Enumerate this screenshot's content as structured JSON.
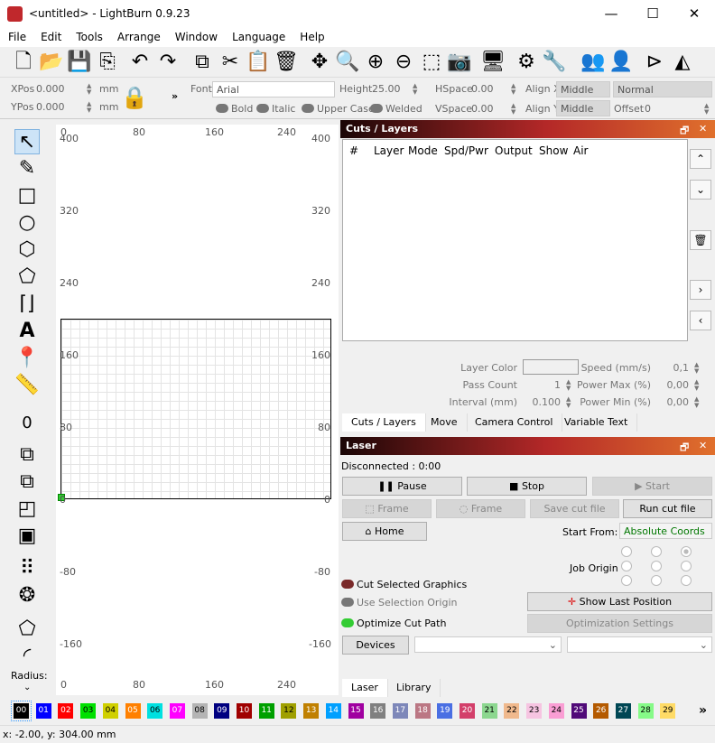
{
  "window": {
    "title": "<untitled> - LightBurn 0.9.23",
    "minimize": "—",
    "maximize": "☐",
    "close": "✕"
  },
  "menu": [
    "File",
    "Edit",
    "Tools",
    "Arrange",
    "Window",
    "Language",
    "Help"
  ],
  "toolbar": [
    "new-file",
    "open",
    "save",
    "import",
    "undo",
    "redo",
    "copy",
    "cut",
    "paste",
    "delete",
    "move",
    "zoom-to-page",
    "zoom-in",
    "zoom-out",
    "select-frame",
    "camera",
    "device",
    "settings",
    "tools",
    "users",
    "user",
    "flip-horizontal",
    "mirror"
  ],
  "props": {
    "xpos_label": "XPos",
    "xpos": "0.000",
    "ypos_label": "YPos",
    "ypos": "0.000",
    "unit": "mm",
    "more": "»",
    "font_label": "Font",
    "font": "Arial",
    "height_label": "Height",
    "height": "25.00",
    "hspace_label": "HSpace",
    "hspace": "0.00",
    "vspace_label": "VSpace",
    "vspace": "0.00",
    "alignx_label": "Align X",
    "alignx": "Middle",
    "aligny_label": "Align Y",
    "aligny": "Middle",
    "style": "Normal",
    "offset_label": "Offset",
    "offset": "0",
    "bold": "Bold",
    "italic": "Italic",
    "upper": "Upper Case",
    "welded": "Welded"
  },
  "tools": {
    "offset_label": "0",
    "radius_label": "Radius:"
  },
  "canvas": {
    "x_ticks": [
      "0",
      "80",
      "160",
      "240"
    ],
    "y_ticks": [
      "400",
      "320",
      "240",
      "160",
      "80",
      "0",
      "-80",
      "-160"
    ]
  },
  "cuts": {
    "title": "Cuts / Layers",
    "columns": [
      "#",
      "Layer",
      "Mode",
      "Spd/Pwr",
      "Output",
      "Show",
      "Air"
    ],
    "layer_color_label": "Layer Color",
    "pass_count_label": "Pass Count",
    "pass_count": "1",
    "interval_label": "Interval (mm)",
    "interval": "0.100",
    "speed_label": "Speed (mm/s)",
    "speed": "0,1",
    "pmax_label": "Power Max (%)",
    "pmax": "0,00",
    "pmin_label": "Power Min (%)",
    "pmin": "0,00",
    "tabs": [
      "Cuts / Layers",
      "Move",
      "Camera Control",
      "Variable Text"
    ]
  },
  "laser": {
    "title": "Laser",
    "status": "Disconnected : 0:00",
    "pause": "Pause",
    "stop": "Stop",
    "start": "Start",
    "frame1": "Frame",
    "frame2": "Frame",
    "save_cut": "Save cut file",
    "run_cut": "Run cut file",
    "home": "Home",
    "start_from_label": "Start From:",
    "start_from": "Absolute Coords",
    "job_origin": "Job Origin",
    "cut_selected": "Cut Selected Graphics",
    "use_sel_origin": "Use Selection Origin",
    "optimize": "Optimize Cut Path",
    "show_last": "Show Last Position",
    "opt_settings": "Optimization Settings",
    "devices": "Devices",
    "tabs": [
      "Laser",
      "Library"
    ]
  },
  "palette": [
    {
      "n": "00",
      "c": "#000000"
    },
    {
      "n": "01",
      "c": "#0000ff"
    },
    {
      "n": "02",
      "c": "#ff0000"
    },
    {
      "n": "03",
      "c": "#00e000"
    },
    {
      "n": "04",
      "c": "#d0d000"
    },
    {
      "n": "05",
      "c": "#ff8000"
    },
    {
      "n": "06",
      "c": "#00e0e0"
    },
    {
      "n": "07",
      "c": "#ff00ff"
    },
    {
      "n": "08",
      "c": "#b4b4b4"
    },
    {
      "n": "09",
      "c": "#000080"
    },
    {
      "n": "10",
      "c": "#a00000"
    },
    {
      "n": "11",
      "c": "#00a000"
    },
    {
      "n": "12",
      "c": "#a0a000"
    },
    {
      "n": "13",
      "c": "#c08000"
    },
    {
      "n": "14",
      "c": "#00a0ff"
    },
    {
      "n": "15",
      "c": "#a000a0"
    },
    {
      "n": "16",
      "c": "#808080"
    },
    {
      "n": "17",
      "c": "#7d87b9"
    },
    {
      "n": "18",
      "c": "#bb7784"
    },
    {
      "n": "19",
      "c": "#4a6fe3"
    },
    {
      "n": "20",
      "c": "#d33f6a"
    },
    {
      "n": "21",
      "c": "#8cd78f"
    },
    {
      "n": "22",
      "c": "#f0b98d"
    },
    {
      "n": "23",
      "c": "#f6c4e1"
    },
    {
      "n": "24",
      "c": "#fa9ed4"
    },
    {
      "n": "25",
      "c": "#500a78"
    },
    {
      "n": "26",
      "c": "#b45a00"
    },
    {
      "n": "27",
      "c": "#004754"
    },
    {
      "n": "28",
      "c": "#86fa88"
    },
    {
      "n": "29",
      "c": "#ffdb66"
    }
  ],
  "palette_more": "»",
  "status": "x: -2.00, y: 304.00 mm",
  "colors": {
    "panel_header_start": "#1a0606",
    "panel_header_mid": "#b42828",
    "panel_header_end": "#e0702c"
  }
}
